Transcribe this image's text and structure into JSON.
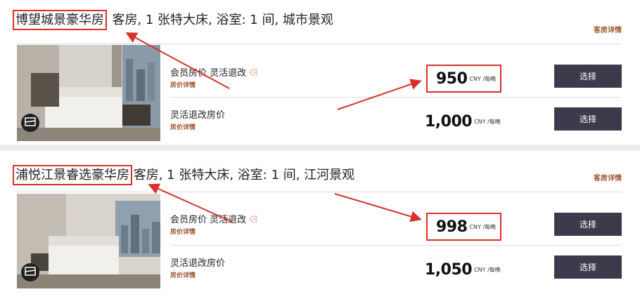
{
  "rooms": [
    {
      "name_highlight": "博望城景豪华房",
      "name_rest": ", 客房, 1 张特大床, 浴室: 1 间, 城市景观",
      "details_link": "客房详情",
      "rates": [
        {
          "name": "会员房价 灵活退改",
          "has_tag": true,
          "link": "房价详情",
          "price": "950",
          "currency": "CNY /每晚",
          "select": "选择"
        },
        {
          "name": "灵活退改房价",
          "has_tag": false,
          "link": "房价详情",
          "price": "1,000",
          "currency": "CNY /每晚",
          "select": "选择"
        }
      ]
    },
    {
      "name_highlight": "浦悦江景睿选豪华房",
      "name_rest": " 客房, 1 张特大床, 浴室: 1 间, 江河景观",
      "details_link": "客房详情",
      "rates": [
        {
          "name": "会员房价 灵活退改",
          "has_tag": true,
          "link": "房价详情",
          "price": "998",
          "currency": "CNY /每晚",
          "select": "选择"
        },
        {
          "name": "灵活退改房价",
          "has_tag": false,
          "link": "房价详情",
          "price": "1,050",
          "currency": "CNY /每晚",
          "select": "选择"
        }
      ]
    }
  ],
  "colors": {
    "accent_link": "#a0522d",
    "button": "#3d3a4b",
    "annotation": "#d9302c"
  }
}
